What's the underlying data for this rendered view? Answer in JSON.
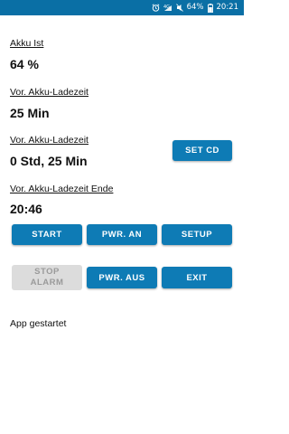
{
  "statusbar": {
    "battery": "64%",
    "time": "20:21",
    "icons": [
      "alarm-icon",
      "signal-4g-icon",
      "mute-icon",
      "battery-icon"
    ]
  },
  "fields": {
    "akku_ist_label": "Akku Ist",
    "akku_ist_value": "64 %",
    "ladezeit_label": "Vor. Akku-Ladezeit",
    "ladezeit_value": "25 Min",
    "ladezeit_cd_label": "Vor. Akku-Ladezeit",
    "ladezeit_cd_value": "0 Std, 25 Min",
    "ladezeit_ende_label": "Vor. Akku-Ladezeit Ende",
    "ladezeit_ende_value": "20:46"
  },
  "buttons": {
    "set_cd": "SET CD",
    "start": "START",
    "pwr_an": "PWR. AN",
    "setup": "SETUP",
    "stop_alarm_line1": "STOP",
    "stop_alarm_line2": "ALARM",
    "pwr_aus": "PWR. AUS",
    "exit": "EXIT"
  },
  "status": {
    "message": "App gestartet"
  },
  "colors": {
    "statusbar": "#0a6fa5",
    "button": "#0e7bb5",
    "button_disabled": "#dcdcdc"
  }
}
